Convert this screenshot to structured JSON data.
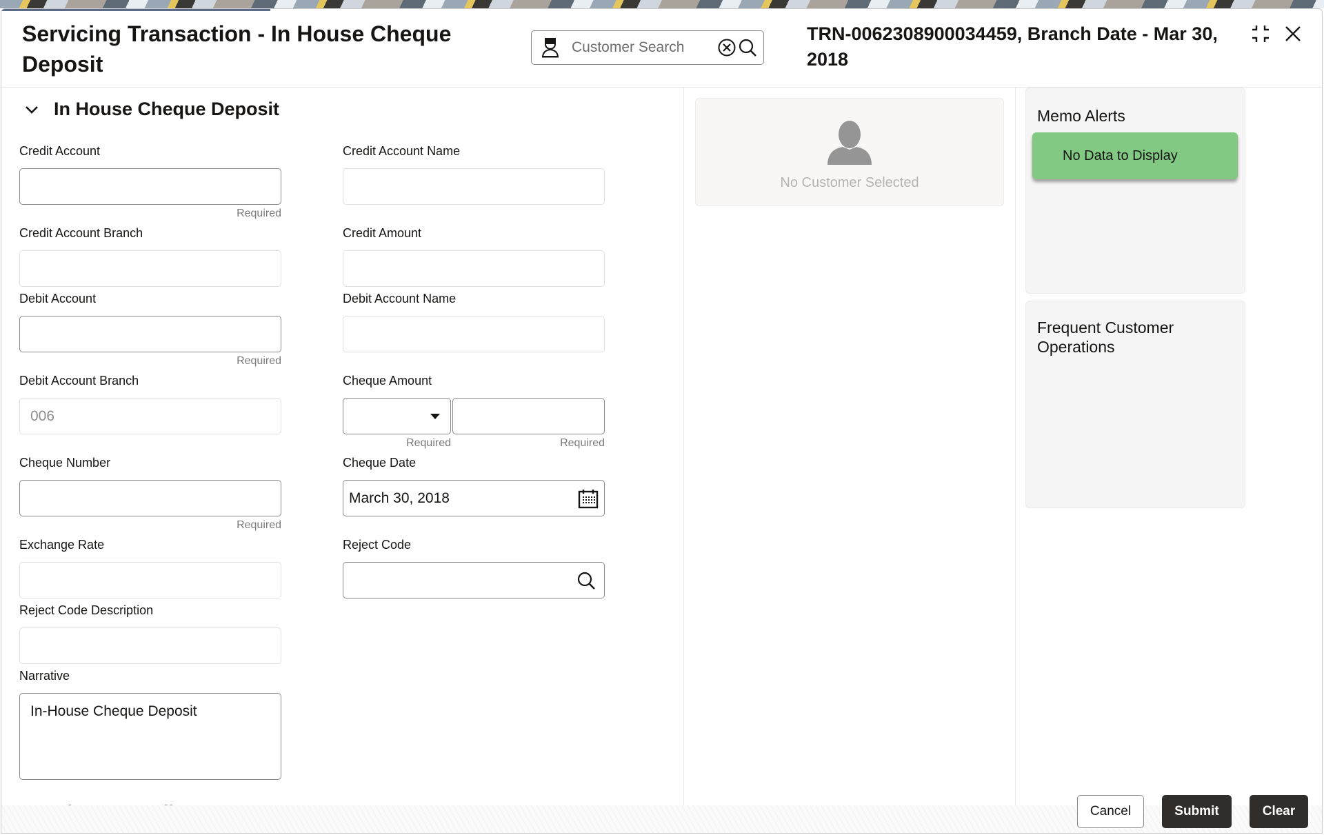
{
  "header": {
    "title": "Servicing Transaction - In House Cheque Deposit",
    "customer_search_placeholder": "Customer Search",
    "transaction_info": "TRN-0062308900034459, Branch Date - Mar 30, 2018"
  },
  "section": {
    "title": "In House Cheque Deposit",
    "expanded": true
  },
  "fields": {
    "credit_account": {
      "label": "Credit Account",
      "value": "",
      "helper": "Required"
    },
    "credit_account_name": {
      "label": "Credit Account Name",
      "value": ""
    },
    "credit_account_branch": {
      "label": "Credit Account Branch",
      "value": ""
    },
    "credit_amount": {
      "label": "Credit Amount",
      "value": ""
    },
    "debit_account": {
      "label": "Debit Account",
      "value": "",
      "helper": "Required"
    },
    "debit_account_name": {
      "label": "Debit Account Name",
      "value": ""
    },
    "debit_account_branch": {
      "label": "Debit Account Branch",
      "value": "006"
    },
    "cheque_amount": {
      "label": "Cheque Amount",
      "currency": "",
      "amount": "",
      "currency_helper": "Required",
      "amount_helper": "Required"
    },
    "cheque_number": {
      "label": "Cheque Number",
      "value": "",
      "helper": "Required"
    },
    "cheque_date": {
      "label": "Cheque Date",
      "value": "March 30, 2018"
    },
    "exchange_rate": {
      "label": "Exchange Rate",
      "value": ""
    },
    "reject_code": {
      "label": "Reject Code",
      "value": ""
    },
    "reject_code_description": {
      "label": "Reject Code Description",
      "value": ""
    },
    "narrative": {
      "label": "Narrative",
      "value": "In-House Cheque Deposit"
    }
  },
  "charge_section": {
    "title": "Charge Details",
    "expanded": false
  },
  "customer_panel": {
    "message": "No Customer Selected"
  },
  "memo_alerts": {
    "title": "Memo Alerts",
    "message": "No Data to Display",
    "color": "#82c984"
  },
  "frequent_ops": {
    "title": "Frequent Customer Operations"
  },
  "buttons": {
    "cancel": "Cancel",
    "submit": "Submit",
    "clear": "Clear"
  }
}
